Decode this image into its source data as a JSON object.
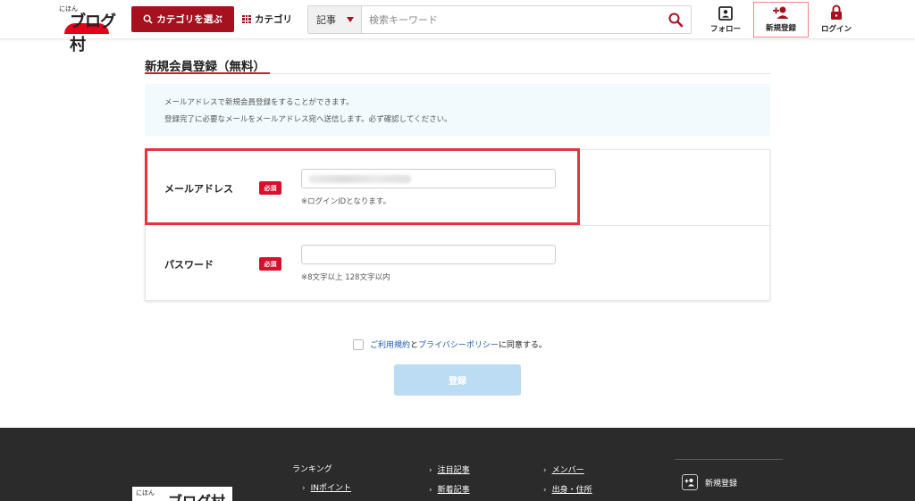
{
  "header": {
    "logo_small": "にほん",
    "logo_main": "ブログ村",
    "category_select_label": "カテゴリを選ぶ",
    "category_link_label": "カテゴリ",
    "search": {
      "type_value": "記事",
      "placeholder": "検索キーワード"
    },
    "follow_label": "フォロー",
    "register_label": "新規登録",
    "login_label": "ログイン"
  },
  "main": {
    "title": "新規会員登録（無料）",
    "info_lines": [
      "メールアドレスで新規会員登録をすることができます。",
      "登録完了に必要なメールをメールアドレス宛へ送信します。必ず確認してください。"
    ],
    "email": {
      "label": "メールアドレス",
      "required": "必須",
      "hint": "※ログインIDとなります。"
    },
    "password": {
      "label": "パスワード",
      "required": "必須",
      "hint": "※8文字以上 128文字以内"
    },
    "agree": {
      "terms": "ご利用規約",
      "and": "と",
      "privacy": "プライバシーポリシー",
      "suffix": "に同意する。"
    },
    "submit_label": "登録"
  },
  "footer": {
    "logo_small": "にほん",
    "logo_main": "ブログ村",
    "ranking_heading": "ランキング",
    "in_point": "INポイント",
    "featured_articles": "注目記事",
    "new_articles": "新着記事",
    "members": "メンバー",
    "hometown": "出身・住所",
    "register": "新規登録"
  },
  "colors": {
    "brand_red": "#a5111f",
    "required_red": "#d8102c",
    "link_blue": "#1a5bb8",
    "highlight": "#e63340"
  }
}
